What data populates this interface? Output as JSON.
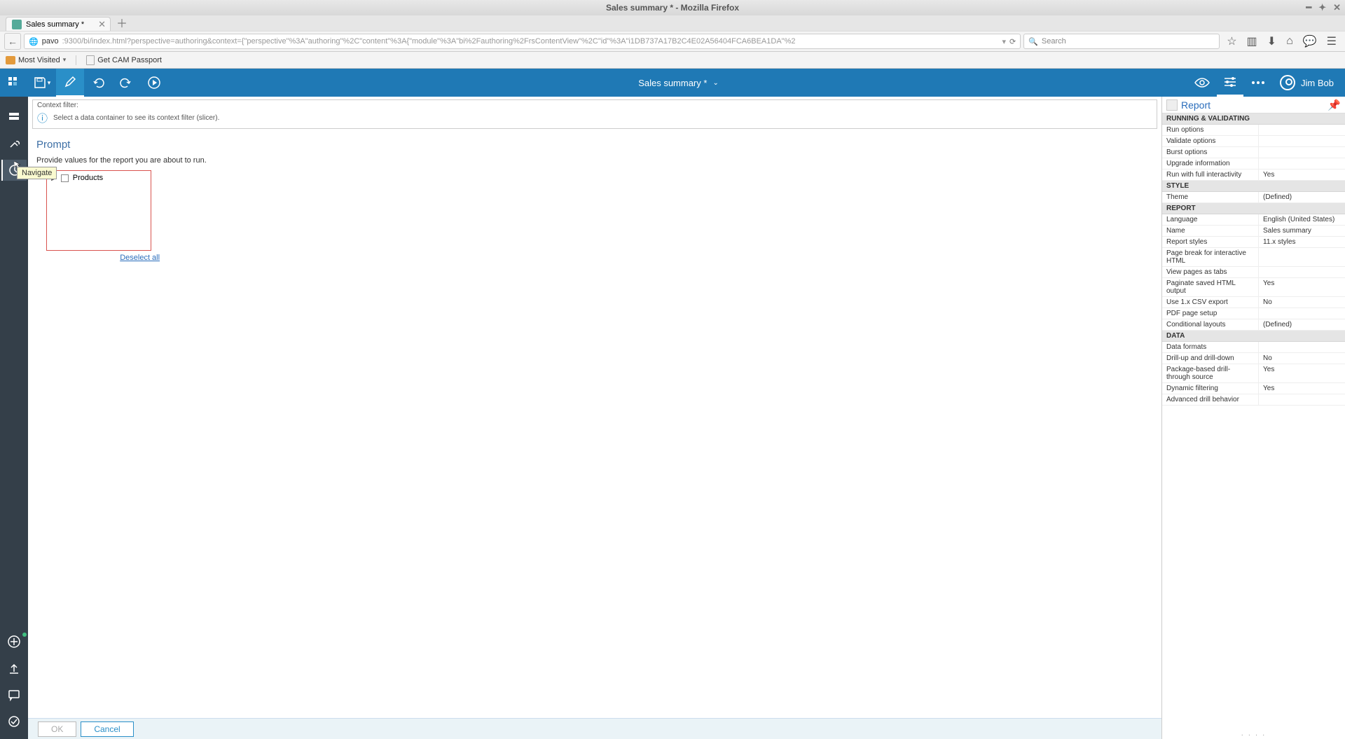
{
  "os": {
    "title": "Sales summary * - Mozilla Firefox"
  },
  "browser": {
    "tab_title": "Sales summary *",
    "url_host": "pavo",
    "url_path": ":9300/bi/index.html?perspective=authoring&context={\"perspective\"%3A\"authoring\"%2C\"content\"%3A{\"module\"%3A\"bi%2Fauthoring%2FrsContentView\"%2C\"id\"%3A\"i1DB737A17B2C4E02A56404FCA6BEA1DA\"%2",
    "search_placeholder": "Search",
    "bookmarks": {
      "most_visited": "Most Visited",
      "cam": "Get CAM Passport"
    }
  },
  "toolbar": {
    "doc_title": "Sales summary *",
    "user": "Jim Bob"
  },
  "left_rail": {
    "tooltip": "Navigate"
  },
  "context_filter": {
    "label": "Context filter:",
    "message": "Select a data container to see its context filter (slicer)."
  },
  "prompt": {
    "title": "Prompt",
    "desc": "Provide values for the report you are about to run.",
    "tree_item": "Products",
    "deselect": "Deselect all"
  },
  "buttons": {
    "ok": "OK",
    "cancel": "Cancel"
  },
  "properties": {
    "header": "Report",
    "sections": [
      {
        "title": "RUNNING & VALIDATING",
        "rows": [
          {
            "label": "Run options",
            "value": ""
          },
          {
            "label": "Validate options",
            "value": ""
          },
          {
            "label": "Burst options",
            "value": ""
          },
          {
            "label": "Upgrade information",
            "value": ""
          },
          {
            "label": "Run with full interactivity",
            "value": "Yes"
          }
        ]
      },
      {
        "title": "STYLE",
        "rows": [
          {
            "label": "Theme",
            "value": "(Defined)"
          }
        ]
      },
      {
        "title": "REPORT",
        "rows": [
          {
            "label": "Language",
            "value": "English (United States)"
          },
          {
            "label": "Name",
            "value": "Sales summary"
          },
          {
            "label": "Report styles",
            "value": "11.x styles"
          },
          {
            "label": "Page break for interactive HTML",
            "value": ""
          },
          {
            "label": "View pages as tabs",
            "value": ""
          },
          {
            "label": "Paginate saved HTML output",
            "value": "Yes"
          },
          {
            "label": "Use 1.x CSV export",
            "value": "No"
          },
          {
            "label": "PDF page setup",
            "value": ""
          },
          {
            "label": "Conditional layouts",
            "value": "(Defined)"
          }
        ]
      },
      {
        "title": "DATA",
        "rows": [
          {
            "label": "Data formats",
            "value": ""
          },
          {
            "label": "Drill-up and drill-down",
            "value": "No"
          },
          {
            "label": "Package-based drill-through source",
            "value": "Yes"
          },
          {
            "label": "Dynamic filtering",
            "value": "Yes"
          },
          {
            "label": "Advanced drill behavior",
            "value": ""
          }
        ]
      }
    ]
  }
}
